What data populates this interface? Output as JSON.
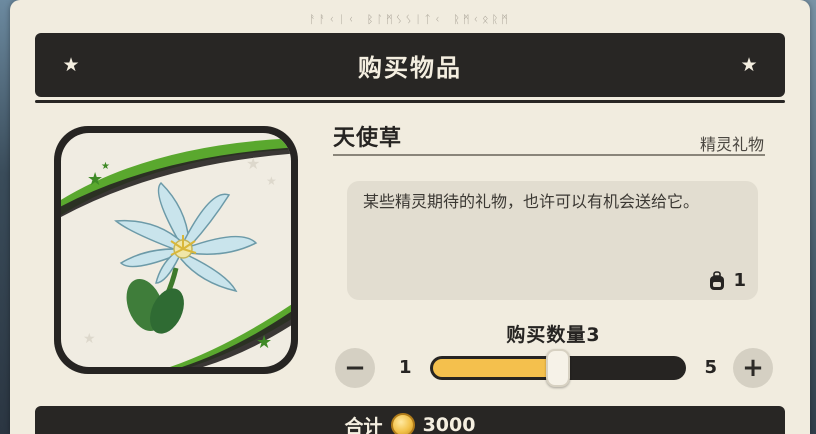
{
  "header": {
    "rune_text": "ᚨᚨᚲᛁᚲ ᛒᛚᛗᛊᛊᛁᛏᚲ ᚱᛗᚲᛟᚱᛗ",
    "title": "购买物品"
  },
  "item": {
    "name": "天使草",
    "category": "精灵礼物",
    "description": "某些精灵期待的礼物，也许可以有机会送给它。",
    "owned_count": "1",
    "image_icon": "white-lily-flower-icon"
  },
  "quantity": {
    "label": "购买数量3",
    "min": "1",
    "max": "5",
    "value": 3,
    "minus_label": "−",
    "plus_label": "+"
  },
  "total": {
    "label": "合计",
    "value": "3000",
    "currency_icon": "gold-coin-icon"
  },
  "colors": {
    "dark": "#282624",
    "panel": "#f1ecdf",
    "accent_yellow": "#f4c04d",
    "accent_green": "#5aa82e"
  }
}
